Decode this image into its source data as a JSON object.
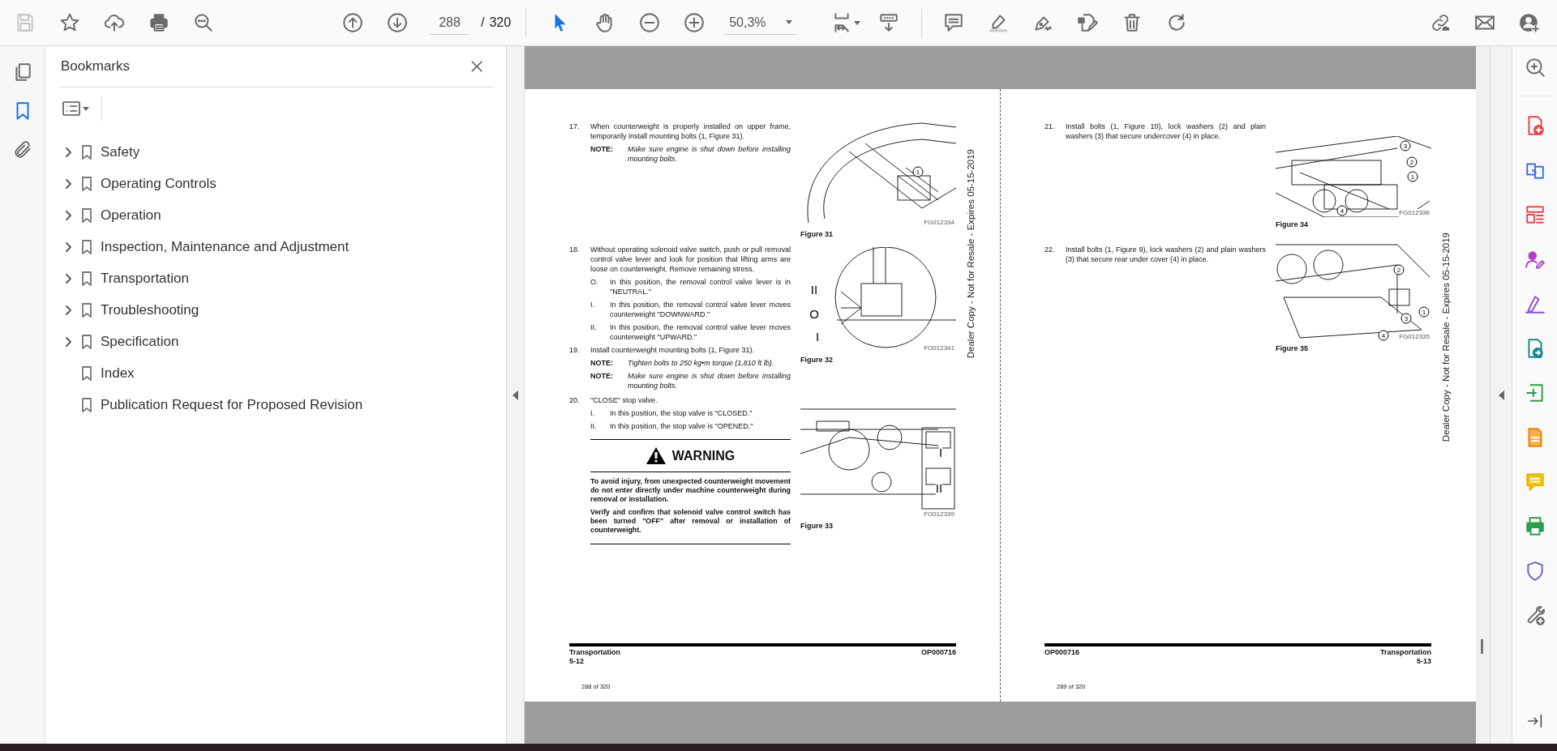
{
  "toolbar": {
    "save_disabled": true,
    "page_number": "288",
    "page_separator": "/",
    "page_total": "320",
    "zoom": "50,3%",
    "tools": [
      {
        "kind": "select",
        "selected": true
      },
      {
        "kind": "hand",
        "selected": false
      }
    ]
  },
  "left_rail": [
    {
      "kind": "pages",
      "selected": false
    },
    {
      "kind": "bookmarks",
      "selected": true
    },
    {
      "kind": "attachments",
      "selected": false
    }
  ],
  "bookmarks_panel": {
    "title": "Bookmarks",
    "items": [
      {
        "label": "Safety",
        "kind": "group"
      },
      {
        "label": "Operating Controls",
        "kind": "group"
      },
      {
        "label": "Operation",
        "kind": "group"
      },
      {
        "label": "Inspection, Maintenance and Adjustment",
        "kind": "group"
      },
      {
        "label": "Transportation",
        "kind": "group"
      },
      {
        "label": "Troubleshooting",
        "kind": "group"
      },
      {
        "label": "Specification",
        "kind": "group"
      },
      {
        "label": "Index",
        "kind": "leaf"
      },
      {
        "label": "Publication Request for Proposed Revision",
        "kind": "leaf"
      }
    ]
  },
  "pages": [
    {
      "steps": [
        {
          "number": "17.",
          "text": "When counterweight is properly installed on upper frame, temporarily install mounting bolts (1, Figure 31).",
          "notes": [
            {
              "label": "NOTE:",
              "text": "Make sure engine is shut down before installing mounting bolts."
            }
          ]
        },
        {
          "number": "18.",
          "text": "Without operating solenoid valve switch, push or pull removal control valve lever and look for position that lifting arms are loose on counterweight. Remove remaining stress.",
          "substeps": [
            {
              "label": "O.",
              "text": "In this position, the removal control valve lever is in \"NEUTRAL.\""
            },
            {
              "label": "I.",
              "text": "In this position, the removal control valve lever moves counterweight \"DOWNWARD.\""
            },
            {
              "label": "II.",
              "text": "In this position, the removal control valve lever moves counterweight \"UPWARD.\""
            }
          ]
        },
        {
          "number": "19.",
          "text": "Install counterweight mounting bolts (1, Figure 31).",
          "notes": [
            {
              "label": "NOTE:",
              "text": "Tighten bolts to 250 kg•m torque (1,810 ft lb)."
            },
            {
              "label": "NOTE:",
              "text": "Make sure engine is shut down before installing mounting bolts."
            }
          ]
        },
        {
          "number": "20.",
          "text": "\"CLOSE\" stop valve.",
          "substeps": [
            {
              "label": "I.",
              "text": "In this position, the stop valve is \"CLOSED.\""
            },
            {
              "label": "II.",
              "text": "In this position, the stop valve is \"OPENED.\""
            }
          ]
        }
      ],
      "warning": {
        "title": "WARNING",
        "paragraphs": [
          "To avoid injury, from unexpected counterweight movement do not enter directly under machine counterweight during removal or installation.",
          "Verify and confirm that solenoid valve control switch has been turned \"OFF\" after removal or installation of counterweight."
        ]
      },
      "figures": [
        {
          "kind": "cover",
          "caption": "Figure 31",
          "code": "FG012334",
          "callouts": [
            {
              "label": "1",
              "kind": "circle"
            }
          ]
        },
        {
          "kind": "valve",
          "caption": "Figure 32",
          "code": "FG012341",
          "callouts": [
            {
              "label": "II",
              "kind": "plain"
            },
            {
              "label": "O",
              "kind": "plain"
            },
            {
              "label": "I",
              "kind": "plain"
            }
          ]
        },
        {
          "kind": "stopvalve",
          "caption": "Figure 33",
          "code": "FG012339",
          "callouts": [
            {
              "label": "I",
              "kind": "plain"
            },
            {
              "label": "II",
              "kind": "plain"
            }
          ]
        }
      ],
      "side_text": "Dealer Copy - Not for Resale - Expires 05-15-2019",
      "footer": {
        "left": [
          "Transportation",
          "5-12"
        ],
        "right": [
          "OP000716"
        ]
      },
      "page_count": "288 of 320"
    },
    {
      "steps": [
        {
          "number": "21.",
          "text": "Install bolts (1, Figure 10), lock washers (2) and plain washers (3) that secure undercover (4) in place."
        },
        {
          "number": "22.",
          "text": "Install bolts (1, Figure 9), lock washers (2) and plain washers (3) that secure rear under cover (4) in place."
        }
      ],
      "figures": [
        {
          "kind": "undercover",
          "caption": "Figure 34",
          "code": "FG012336",
          "callouts": [
            {
              "label": "3",
              "kind": "circle"
            },
            {
              "label": "2",
              "kind": "circle"
            },
            {
              "label": "1",
              "kind": "circle"
            },
            {
              "label": "4",
              "kind": "circle"
            }
          ]
        },
        {
          "kind": "rearcover",
          "caption": "Figure 35",
          "code": "FG012335",
          "callouts": [
            {
              "label": "2",
              "kind": "circle"
            },
            {
              "label": "1",
              "kind": "circle"
            },
            {
              "label": "3",
              "kind": "circle"
            },
            {
              "label": "4",
              "kind": "circle"
            }
          ]
        }
      ],
      "side_text": "Dealer Copy - Not for Resale - Expires 05-15-2019",
      "footer": {
        "left": [
          "OP000716"
        ],
        "right": [
          "Transportation",
          "5-13"
        ]
      },
      "page_count": "289 of 320"
    }
  ]
}
